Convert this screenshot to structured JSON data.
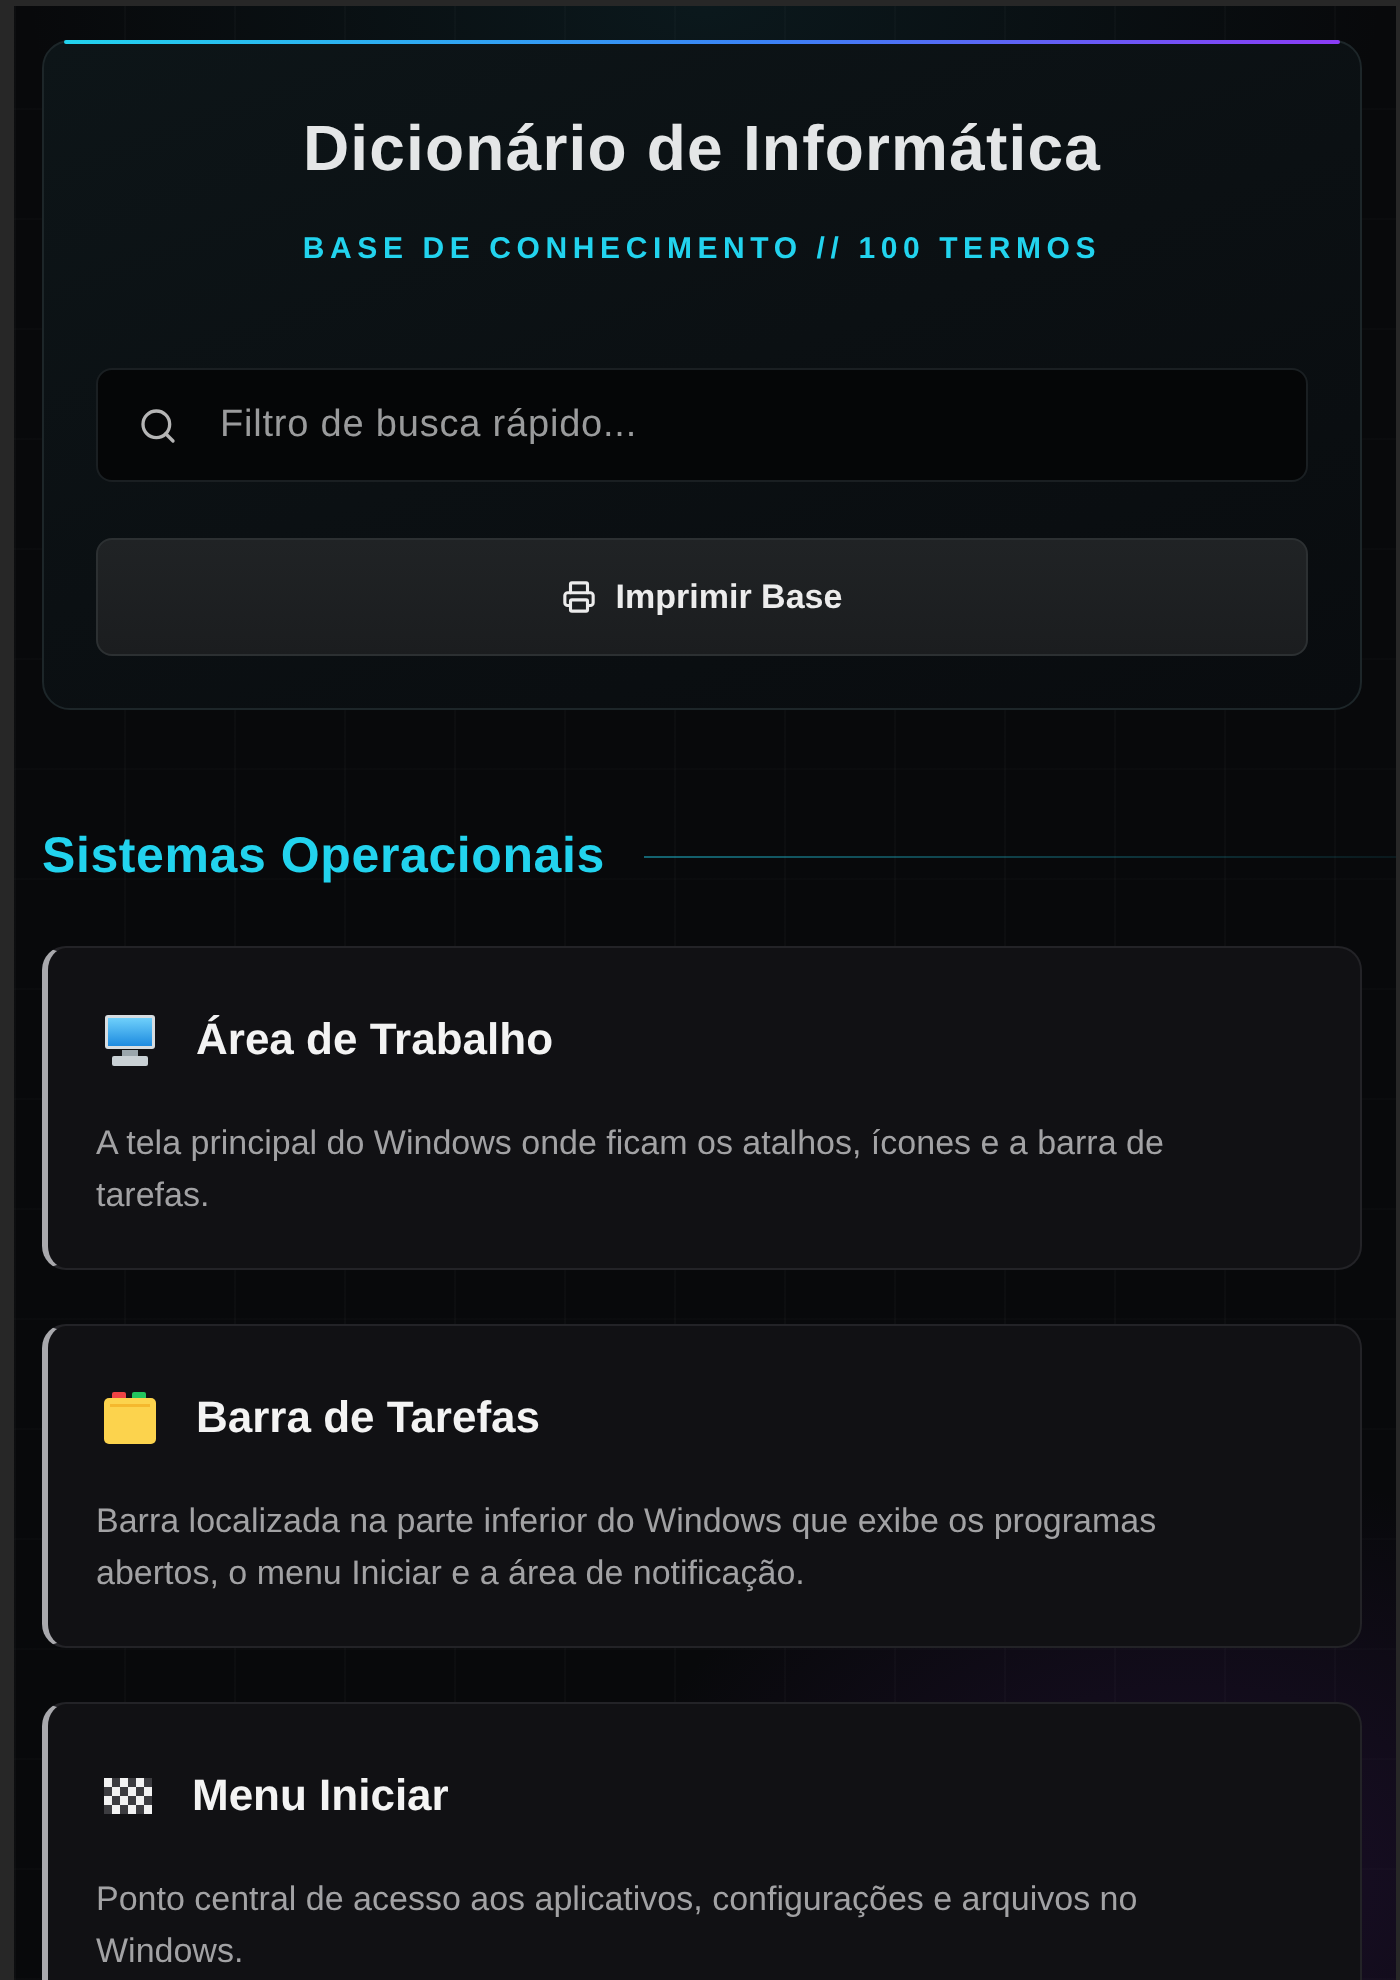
{
  "header": {
    "title": "Dicionário de Informática",
    "subtitle": "BASE DE CONHECIMENTO // 100 TERMOS",
    "search": {
      "placeholder": "Filtro de busca rápido..."
    },
    "print_button": "Imprimir Base"
  },
  "sections": [
    {
      "title": "Sistemas Operacionais",
      "terms": [
        {
          "kind": "monitor",
          "term": "Área de Trabalho",
          "definition": "A tela principal do Windows onde ficam os atalhos, ícones e a barra de tarefas."
        },
        {
          "kind": "folder",
          "term": "Barra de Tarefas",
          "definition": "Barra localizada na parte inferior do Windows que exibe os programas abertos, o menu Iniciar e a área de notificação."
        },
        {
          "kind": "flag",
          "term": "Menu Iniciar",
          "definition": "Ponto central de acesso aos aplicativos, configurações e arquivos no Windows."
        }
      ]
    }
  ]
}
